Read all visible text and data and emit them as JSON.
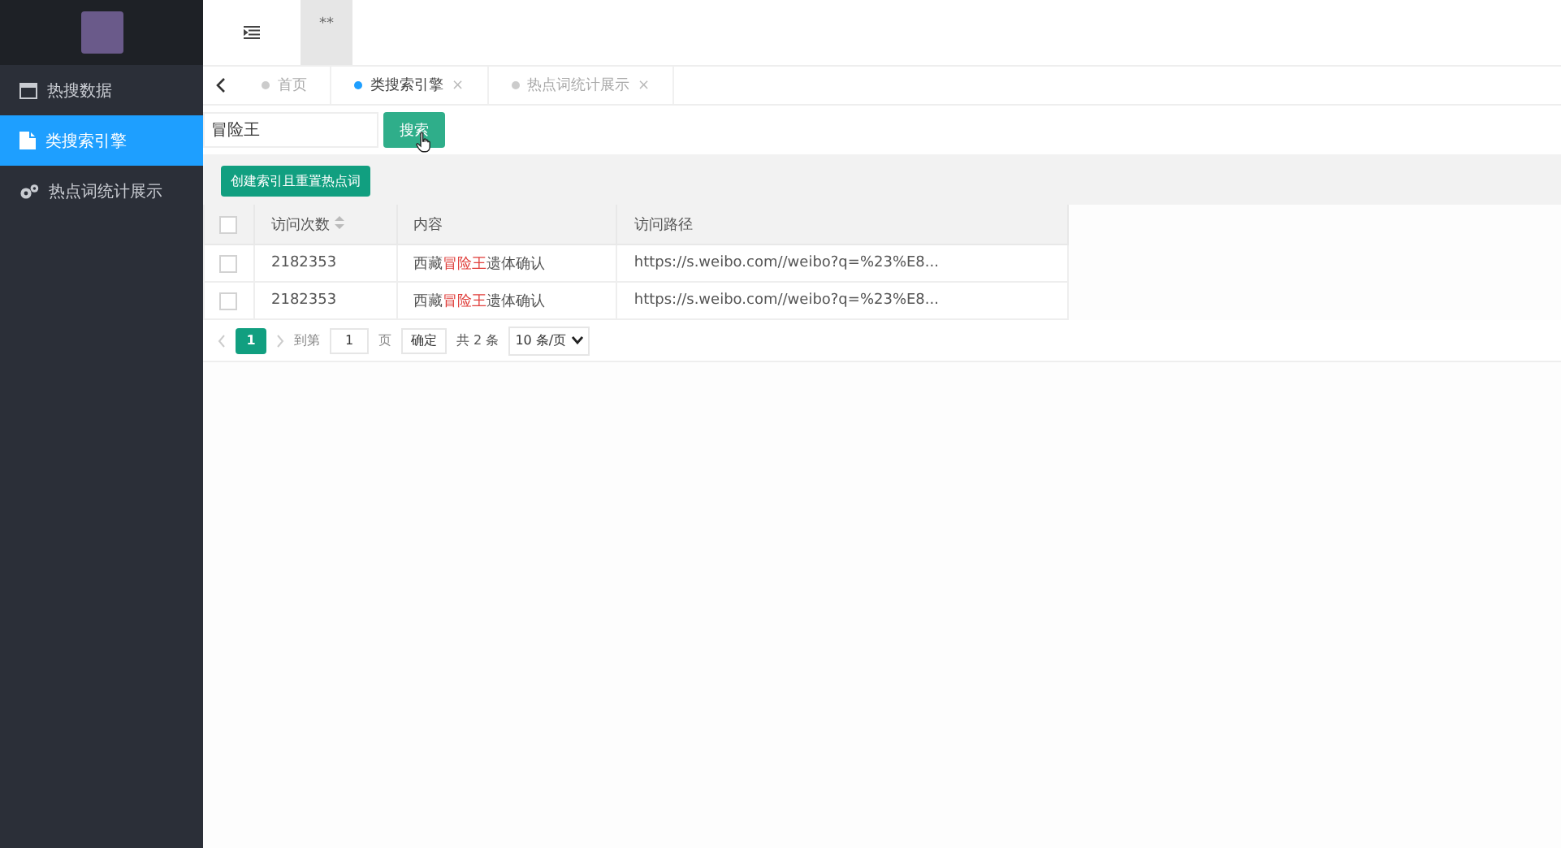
{
  "sidebar": {
    "items": [
      {
        "label": "热搜数据",
        "selected": false
      },
      {
        "label": "类搜索引擎",
        "selected": true
      },
      {
        "label": "热点词统计展示",
        "selected": false
      }
    ]
  },
  "header": {
    "menu_glyph": "**"
  },
  "tabs": [
    {
      "label": "首页",
      "selected": false
    },
    {
      "label": "类搜索引擎",
      "selected": true,
      "close": "×"
    },
    {
      "label": "热点词统计展示",
      "selected": false,
      "close": "×"
    }
  ],
  "search": {
    "value": "冒险王",
    "button": "搜索"
  },
  "action_button": "创建索引且重置热点词",
  "table": {
    "all_checked": false,
    "columns": [
      {
        "label": "访问次数",
        "sortable": true
      },
      {
        "label": "内容",
        "sortable": false
      },
      {
        "label": "访问路径",
        "sortable": false
      }
    ],
    "rows": [
      {
        "checked": false,
        "count": "2182353",
        "content": {
          "before": "西藏",
          "highlight": "冒险王",
          "after": "遗体确认"
        },
        "url": "https://s.weibo.com//weibo?q=%23%E8..."
      },
      {
        "checked": false,
        "count": "2182353",
        "content": {
          "before": "西藏",
          "highlight": "冒险王",
          "after": "遗体确认"
        },
        "url": "https://s.weibo.com//weibo?q=%23%E8..."
      }
    ]
  },
  "pagination": {
    "pages": [
      {
        "label": "1",
        "selected": true
      }
    ],
    "goto_label": "到第",
    "goto_value": "1",
    "page_unit": "页",
    "confirm": "确定",
    "total": "共 2 条",
    "page_size": "10 条/页"
  }
}
